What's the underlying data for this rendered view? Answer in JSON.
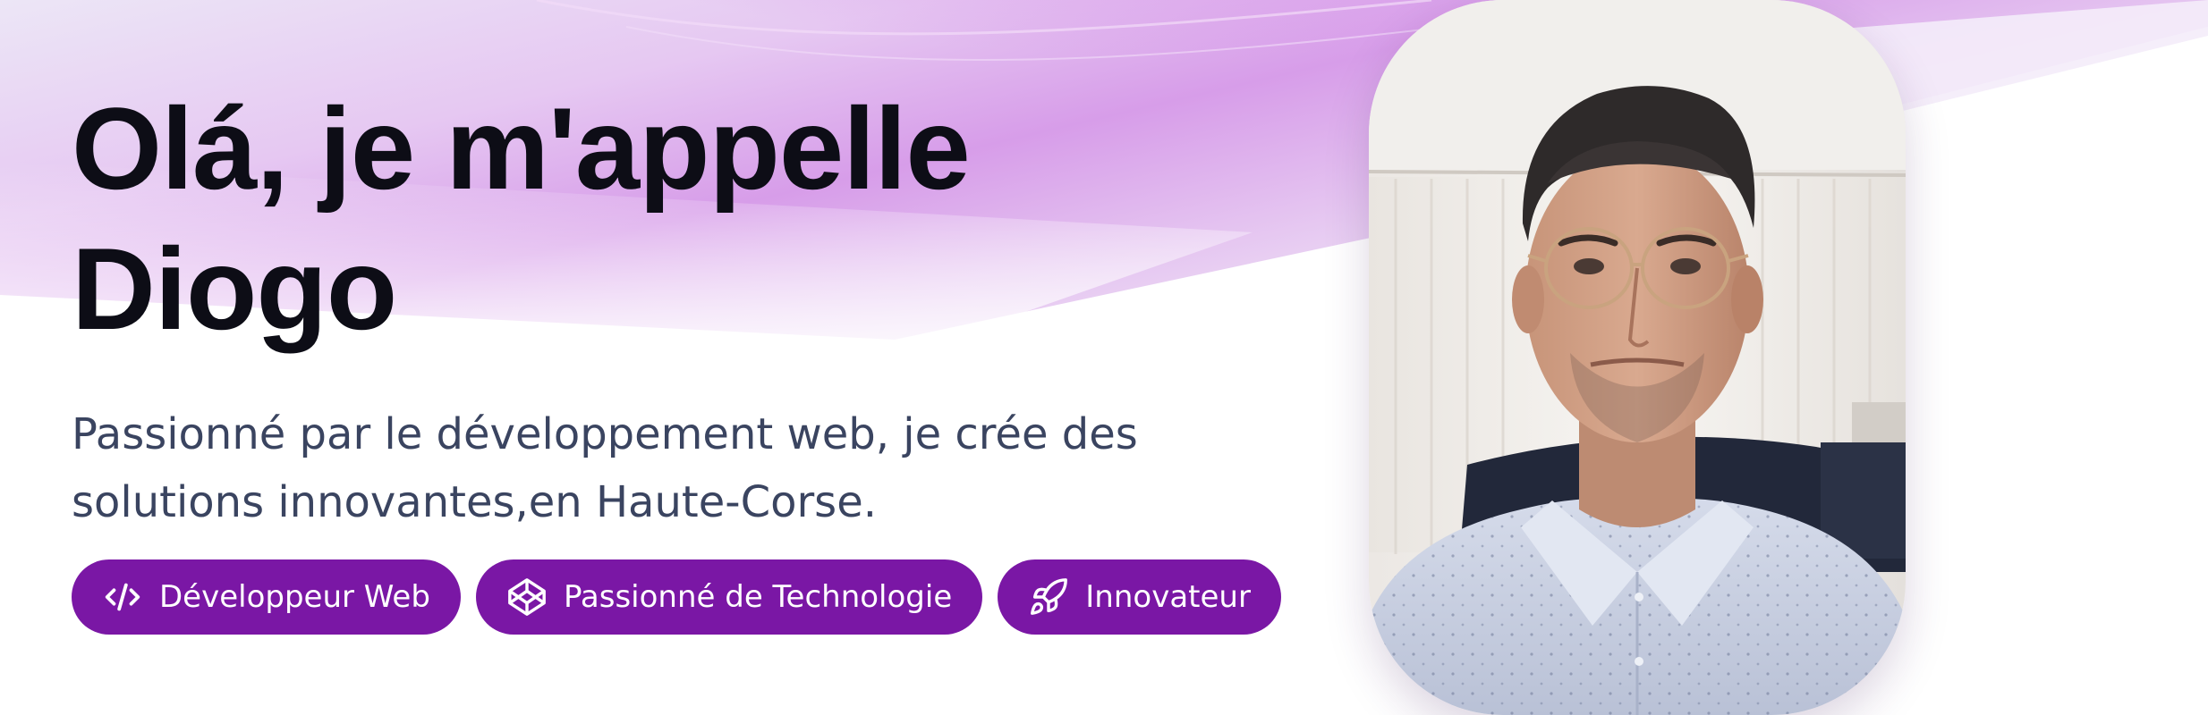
{
  "hero": {
    "title_line1": "Olá, je m'appelle",
    "title_line2": "Diogo",
    "subtitle": "Passionné par le développement web, je crée des solutions innovantes,en Haute-Corse.",
    "badges": [
      {
        "label": "Développeur Web",
        "icon": "code-icon"
      },
      {
        "label": "Passionné de Technologie",
        "icon": "codepen-cube-icon"
      },
      {
        "label": "Innovateur",
        "icon": "rocket-icon"
      }
    ],
    "portrait_alt": "Diogo"
  },
  "colors": {
    "badge_bg": "#7a17a5",
    "title": "#0d0d16",
    "subtitle": "#3a4460",
    "gradient_purple": "#c98be8"
  }
}
